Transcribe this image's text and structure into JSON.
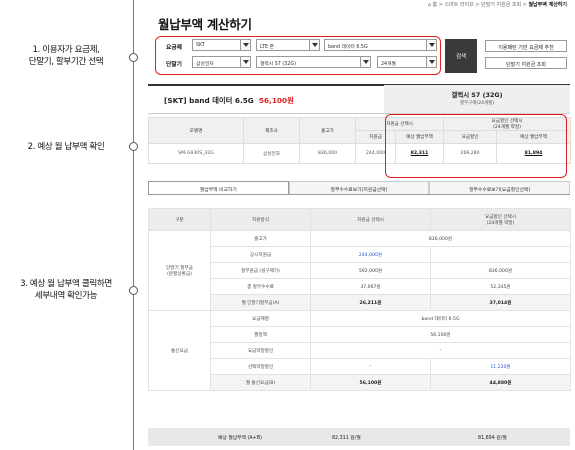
{
  "breadcrumb": [
    "홈",
    "스마트 라이프",
    "단말기 지원금 조회",
    "월납부액 계산하기"
  ],
  "title": "월납부액 계산하기",
  "annotations": [
    "1.  이용자가 요금제,\n단말기, 할부기간 선택",
    "2. 예상 월 납부액 확인",
    "3. 예상 월 납부액 클릭하면\n세부내역 확인가능"
  ],
  "form": {
    "plan_label": "요금제",
    "device_label": "단말기",
    "carrier": "SKT",
    "network": "LTE 폰",
    "plan": "band 데이터 6.5G",
    "maker": "삼성전자",
    "model": "갤럭시 S7 (32G)",
    "months": "24개월",
    "search_button": "검색",
    "recommend_button": "이용패턴 기반 요금제 추천",
    "subsidy_button": "단말기 지원금 조회"
  },
  "plan_summary": {
    "name": "[SKT] band 데이터 6.5G",
    "price": "56,100원",
    "device": "갤럭시 S7 (32G)",
    "months": "할부구매(24개월)"
  },
  "device_table": {
    "headers": [
      "모델명",
      "제조사",
      "출고가",
      "지원금 선택시",
      "요금할인 선택시\n(24개월 약정)"
    ],
    "sub": [
      "지원금",
      "예상 월납부액",
      "요금할인",
      "예상 월납부액"
    ],
    "row": [
      "SM-G930S_32G",
      "삼성전자",
      "836,000",
      "244,000",
      "82,311",
      "269,280",
      "81,894"
    ]
  },
  "tabs": [
    "월납부액 비교하기",
    "할부수수료보기(지원금선택)",
    "할부수수료보기(요금할인선택)"
  ],
  "compare": {
    "headers": [
      "구분",
      "지원방식",
      "지원금 선택시",
      "요금할인 선택시\n(24개월 약정)"
    ],
    "group1": "단말기 할부금\n(분할상환금)",
    "group2": "통신요금",
    "rows1": [
      {
        "k": "출고가",
        "merged": "836,000원"
      },
      {
        "k": "공시지원금",
        "a": "244,000원",
        "b": ""
      },
      {
        "k": "할부원금 (실구매가)",
        "a": "592,000원",
        "b": "836,000원"
      },
      {
        "k": "총 할부수수료",
        "a": "37,067원",
        "b": "52,345원"
      },
      {
        "k": "월 단말기할부금(A)",
        "a": "26,211원",
        "b": "37,014원"
      }
    ],
    "rows2": [
      {
        "k": "요금제명",
        "merged": "band 데이터 6.5G"
      },
      {
        "k": "월정액",
        "merged": "56,100원"
      },
      {
        "k": "요금약정할인",
        "merged": "-"
      },
      {
        "k": "선택약정할인",
        "a": "-",
        "b": "11,220원"
      },
      {
        "k": "월 통신요금(B)",
        "a": "56,100원",
        "b": "44,880원"
      }
    ],
    "footer": {
      "label": "예상 월납부액 (A+B)",
      "a": "82,311 원/월",
      "b": "81,894 원/월"
    }
  }
}
